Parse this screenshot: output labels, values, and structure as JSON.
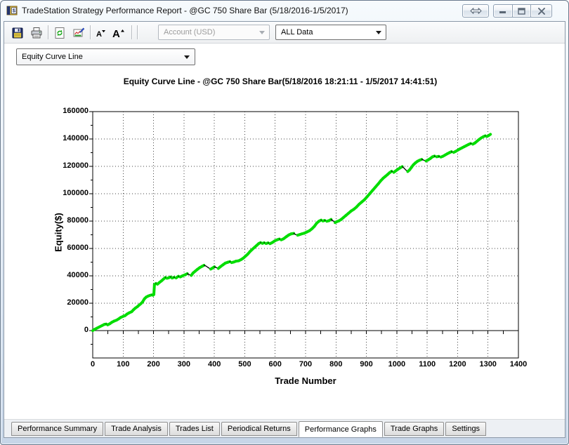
{
  "window": {
    "title": "TradeStation Strategy Performance Report - @GC 750 Share Bar (5/18/2016-1/5/2017)",
    "controls": {
      "undock": "undock",
      "minimize": "minimize",
      "restore": "restore-down",
      "close": "close"
    }
  },
  "toolbar": {
    "buttons": [
      "save",
      "print",
      "refresh",
      "customize-report",
      "decrease-font",
      "increase-font"
    ],
    "account_combo": {
      "value": "Account (USD)",
      "disabled": true
    },
    "data_range_combo": {
      "value": "ALL Data",
      "disabled": false
    }
  },
  "graph_selector": {
    "value": "Equity Curve Line"
  },
  "tabs": [
    {
      "label": "Performance Summary",
      "active": false
    },
    {
      "label": "Trade Analysis",
      "active": false
    },
    {
      "label": "Trades List",
      "active": false
    },
    {
      "label": "Periodical Returns",
      "active": false
    },
    {
      "label": "Performance Graphs",
      "active": true
    },
    {
      "label": "Trade Graphs",
      "active": false
    },
    {
      "label": "Settings",
      "active": false
    }
  ],
  "chart_data": {
    "type": "line",
    "title": "Equity Curve Line - @GC 750 Share Bar(5/18/2016 18:21:11 - 1/5/2017 14:41:51)",
    "xlabel": "Trade Number",
    "ylabel": "Equity($)",
    "xlim": [
      0,
      1400
    ],
    "ylim": [
      -20000,
      160000
    ],
    "grid": "dotted",
    "legend": "none",
    "x_ticks": [
      0,
      100,
      200,
      300,
      400,
      500,
      600,
      700,
      800,
      900,
      1000,
      1100,
      1200,
      1300,
      1400
    ],
    "y_ticks": [
      0,
      20000,
      40000,
      60000,
      80000,
      100000,
      120000,
      140000,
      160000
    ],
    "colors": {
      "rising": "#00dd00",
      "falling": "#000000"
    },
    "series": [
      {
        "name": "Equity",
        "points": [
          [
            0,
            0
          ],
          [
            6,
            900
          ],
          [
            14,
            1800
          ],
          [
            22,
            2700
          ],
          [
            30,
            3600
          ],
          [
            38,
            4500
          ],
          [
            44,
            4800
          ],
          [
            49,
            4200
          ],
          [
            56,
            5000
          ],
          [
            63,
            6100
          ],
          [
            70,
            6900
          ],
          [
            78,
            7600
          ],
          [
            85,
            8500
          ],
          [
            92,
            9600
          ],
          [
            100,
            10400
          ],
          [
            106,
            10900
          ],
          [
            113,
            12100
          ],
          [
            120,
            13000
          ],
          [
            128,
            13800
          ],
          [
            134,
            15200
          ],
          [
            140,
            16400
          ],
          [
            147,
            17500
          ],
          [
            153,
            18700
          ],
          [
            159,
            19800
          ],
          [
            164,
            21000
          ],
          [
            170,
            23200
          ],
          [
            176,
            24500
          ],
          [
            182,
            25200
          ],
          [
            188,
            25700
          ],
          [
            194,
            26100
          ],
          [
            198,
            25800
          ],
          [
            201,
            26400
          ],
          [
            203,
            33600
          ],
          [
            208,
            34400
          ],
          [
            213,
            33900
          ],
          [
            219,
            35100
          ],
          [
            226,
            36300
          ],
          [
            233,
            37700
          ],
          [
            239,
            38800
          ],
          [
            244,
            38200
          ],
          [
            250,
            38600
          ],
          [
            256,
            39200
          ],
          [
            261,
            38400
          ],
          [
            267,
            38900
          ],
          [
            274,
            38500
          ],
          [
            282,
            39700
          ],
          [
            288,
            39200
          ],
          [
            296,
            40100
          ],
          [
            304,
            40800
          ],
          [
            311,
            41600
          ],
          [
            317,
            40900
          ],
          [
            324,
            40300
          ],
          [
            330,
            42100
          ],
          [
            337,
            43400
          ],
          [
            344,
            44700
          ],
          [
            352,
            46000
          ],
          [
            359,
            46900
          ],
          [
            366,
            47700
          ],
          [
            373,
            47100
          ],
          [
            380,
            46000
          ],
          [
            388,
            44900
          ],
          [
            394,
            45700
          ],
          [
            400,
            46600
          ],
          [
            406,
            46100
          ],
          [
            413,
            45400
          ],
          [
            420,
            46700
          ],
          [
            428,
            48000
          ],
          [
            436,
            49300
          ],
          [
            444,
            49900
          ],
          [
            451,
            50400
          ],
          [
            457,
            49700
          ],
          [
            464,
            50100
          ],
          [
            471,
            50700
          ],
          [
            480,
            51000
          ],
          [
            488,
            51900
          ],
          [
            495,
            52900
          ],
          [
            503,
            54500
          ],
          [
            510,
            55900
          ],
          [
            517,
            57700
          ],
          [
            525,
            59400
          ],
          [
            532,
            60800
          ],
          [
            539,
            62200
          ],
          [
            546,
            63600
          ],
          [
            552,
            64300
          ],
          [
            558,
            63700
          ],
          [
            564,
            64200
          ],
          [
            570,
            63600
          ],
          [
            577,
            64100
          ],
          [
            583,
            63500
          ],
          [
            591,
            64400
          ],
          [
            599,
            65600
          ],
          [
            607,
            66400
          ],
          [
            614,
            66900
          ],
          [
            620,
            66300
          ],
          [
            627,
            67000
          ],
          [
            636,
            68500
          ],
          [
            645,
            69900
          ],
          [
            653,
            70700
          ],
          [
            661,
            71000
          ],
          [
            667,
            70200
          ],
          [
            674,
            69700
          ],
          [
            681,
            70200
          ],
          [
            688,
            70700
          ],
          [
            696,
            71200
          ],
          [
            704,
            72000
          ],
          [
            713,
            73000
          ],
          [
            721,
            74400
          ],
          [
            729,
            76200
          ],
          [
            737,
            78600
          ],
          [
            744,
            79900
          ],
          [
            751,
            80700
          ],
          [
            757,
            80100
          ],
          [
            763,
            80500
          ],
          [
            770,
            79900
          ],
          [
            777,
            80300
          ],
          [
            784,
            81200
          ],
          [
            790,
            80300
          ],
          [
            797,
            78900
          ],
          [
            803,
            79600
          ],
          [
            810,
            80200
          ],
          [
            817,
            81200
          ],
          [
            825,
            82700
          ],
          [
            833,
            84200
          ],
          [
            841,
            85700
          ],
          [
            850,
            87400
          ],
          [
            859,
            88700
          ],
          [
            867,
            90200
          ],
          [
            876,
            92300
          ],
          [
            885,
            94000
          ],
          [
            894,
            95700
          ],
          [
            903,
            98000
          ],
          [
            912,
            100300
          ],
          [
            921,
            102600
          ],
          [
            930,
            104900
          ],
          [
            939,
            107200
          ],
          [
            947,
            109400
          ],
          [
            955,
            111300
          ],
          [
            962,
            112600
          ],
          [
            969,
            113900
          ],
          [
            976,
            115300
          ],
          [
            983,
            116400
          ],
          [
            990,
            115600
          ],
          [
            997,
            116800
          ],
          [
            1004,
            117900
          ],
          [
            1011,
            118900
          ],
          [
            1018,
            119800
          ],
          [
            1024,
            118700
          ],
          [
            1030,
            117300
          ],
          [
            1036,
            116200
          ],
          [
            1042,
            117400
          ],
          [
            1048,
            119200
          ],
          [
            1054,
            121000
          ],
          [
            1061,
            122500
          ],
          [
            1068,
            123700
          ],
          [
            1075,
            124500
          ],
          [
            1082,
            125100
          ],
          [
            1089,
            124500
          ],
          [
            1096,
            123900
          ],
          [
            1103,
            124700
          ],
          [
            1110,
            125700
          ],
          [
            1117,
            126900
          ],
          [
            1124,
            127500
          ],
          [
            1131,
            127000
          ],
          [
            1138,
            127300
          ],
          [
            1145,
            126800
          ],
          [
            1152,
            127400
          ],
          [
            1159,
            128300
          ],
          [
            1166,
            129200
          ],
          [
            1173,
            130000
          ],
          [
            1180,
            130700
          ],
          [
            1187,
            130200
          ],
          [
            1194,
            131000
          ],
          [
            1201,
            131900
          ],
          [
            1208,
            132800
          ],
          [
            1215,
            133600
          ],
          [
            1222,
            134400
          ],
          [
            1229,
            135200
          ],
          [
            1236,
            136000
          ],
          [
            1243,
            136700
          ],
          [
            1250,
            136200
          ],
          [
            1257,
            137100
          ],
          [
            1264,
            138400
          ],
          [
            1271,
            139700
          ],
          [
            1278,
            140800
          ],
          [
            1285,
            141700
          ],
          [
            1291,
            142300
          ],
          [
            1296,
            141800
          ],
          [
            1302,
            142500
          ],
          [
            1308,
            143400
          ]
        ]
      }
    ]
  }
}
